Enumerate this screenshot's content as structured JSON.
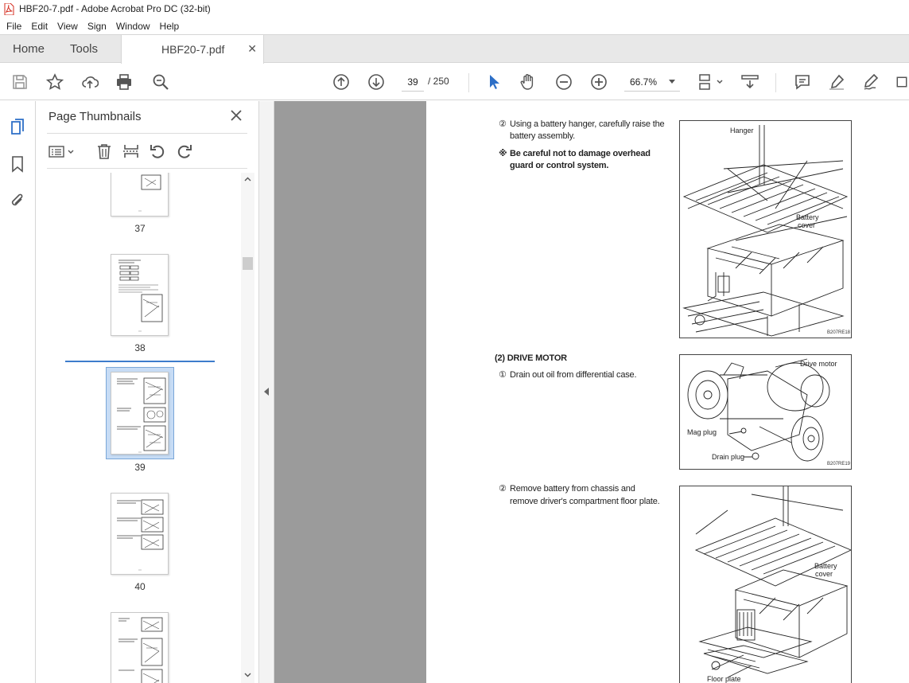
{
  "window": {
    "title": "HBF20-7.pdf - Adobe Acrobat Pro DC (32-bit)"
  },
  "menu": [
    "File",
    "Edit",
    "View",
    "Sign",
    "Window",
    "Help"
  ],
  "tabs": {
    "home": "Home",
    "tools": "Tools",
    "document": "HBF20-7.pdf"
  },
  "toolbar": {
    "current_page": "39",
    "page_total": "/ 250",
    "zoom": "66.7%"
  },
  "panel": {
    "title": "Page Thumbnails"
  },
  "thumbnails": [
    {
      "label": "37"
    },
    {
      "label": "38"
    },
    {
      "label": "39",
      "selected": true
    },
    {
      "label": "40"
    }
  ],
  "page": {
    "step1_num": "②",
    "step1_text_line1": "Using a battery hanger, carefully raise the",
    "step1_text_line2": "battery assembly.",
    "note_mark": "※",
    "note_line1": "Be careful not to damage overhead",
    "note_line2": "guard or control system.",
    "section_heading": "(2) DRIVE MOTOR",
    "step2_num": "①",
    "step2_text": "Drain out oil from differential case.",
    "step3_num": "②",
    "step3_line1": "Remove battery from chassis and",
    "step3_line2": "remove driver's compartment floor plate.",
    "fig1": {
      "label_hanger": "Hanger",
      "label_battery": "Battery",
      "label_cover": "cover",
      "code": "B207RE18"
    },
    "fig2": {
      "label_motor": "Drive motor",
      "label_mag": "Mag plug",
      "label_drain": "Drain plug",
      "code": "B207RE19"
    },
    "fig3": {
      "label_battery": "Battery",
      "label_cover": "cover",
      "label_floor": "Floor plate"
    }
  }
}
